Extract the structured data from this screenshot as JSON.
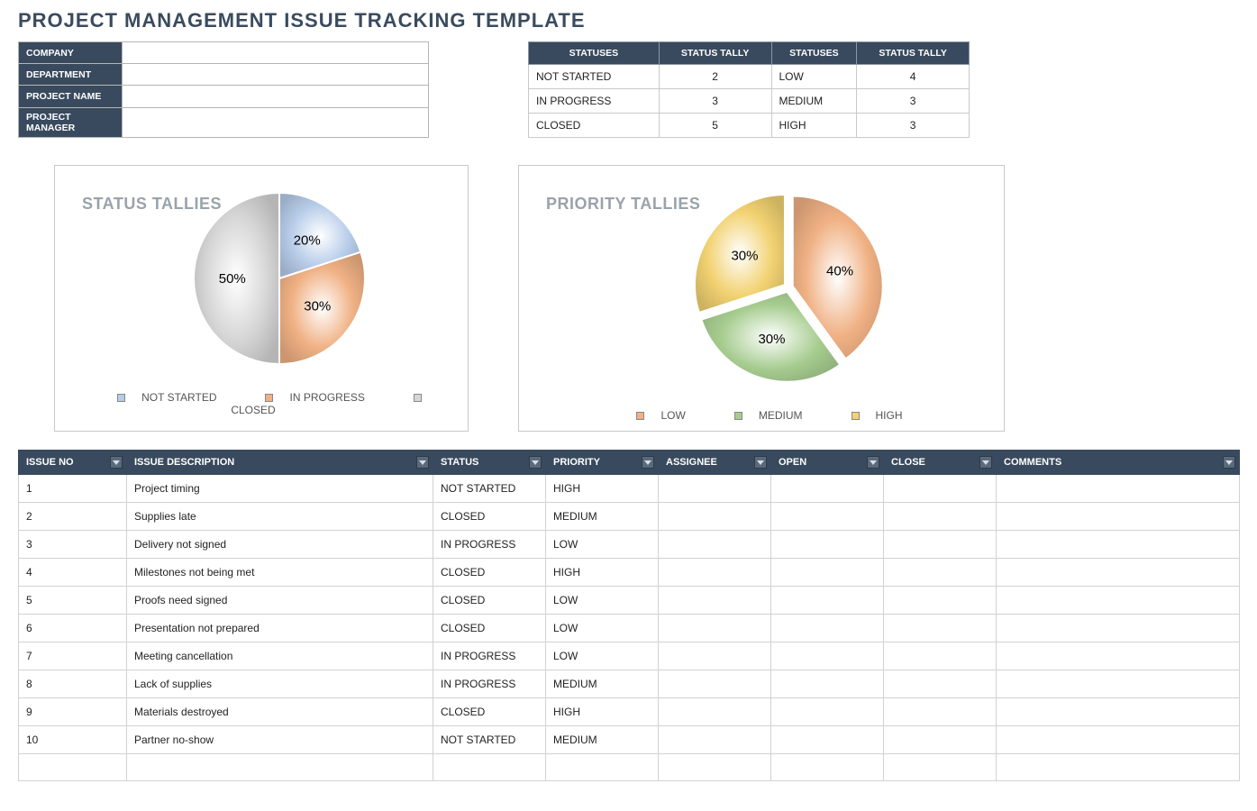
{
  "title": "PROJECT MANAGEMENT ISSUE TRACKING TEMPLATE",
  "info_fields": [
    {
      "label": "COMPANY",
      "value": ""
    },
    {
      "label": "DEPARTMENT",
      "value": ""
    },
    {
      "label": "PROJECT NAME",
      "value": ""
    },
    {
      "label": "PROJECT MANAGER",
      "value": ""
    }
  ],
  "tally_headers": [
    "STATUSES",
    "STATUS TALLY",
    "STATUSES",
    "STATUS TALLY"
  ],
  "tally_rows": [
    {
      "c1": "NOT STARTED",
      "c2": "2",
      "c3": "LOW",
      "c4": "4"
    },
    {
      "c1": "IN PROGRESS",
      "c2": "3",
      "c3": "MEDIUM",
      "c4": "3"
    },
    {
      "c1": "CLOSED",
      "c2": "5",
      "c3": "HIGH",
      "c4": "3"
    }
  ],
  "chart_data": [
    {
      "type": "pie",
      "title": "STATUS TALLIES",
      "categories": [
        "NOT STARTED",
        "IN PROGRESS",
        "CLOSED"
      ],
      "values": [
        2,
        3,
        5
      ],
      "percent_labels": [
        "20%",
        "30%",
        "50%"
      ],
      "colors": [
        "#b7cce9",
        "#f0b184",
        "#d6d6d6"
      ]
    },
    {
      "type": "pie",
      "title": "PRIORITY TALLIES",
      "categories": [
        "LOW",
        "MEDIUM",
        "HIGH"
      ],
      "values": [
        4,
        3,
        3
      ],
      "percent_labels": [
        "40%",
        "30%",
        "30%"
      ],
      "colors": [
        "#f0b184",
        "#a6cc8f",
        "#f2d272"
      ]
    }
  ],
  "issue_headers": [
    "ISSUE NO",
    "ISSUE DESCRIPTION",
    "STATUS",
    "PRIORITY",
    "ASSIGNEE",
    "OPEN",
    "CLOSE",
    "COMMENTS"
  ],
  "issue_col_widths": [
    "120",
    "340",
    "125",
    "125",
    "125",
    "125",
    "125",
    "270"
  ],
  "issues": [
    {
      "no": "1",
      "desc": "Project timing",
      "status": "NOT STARTED",
      "priority": "HIGH",
      "assignee": "",
      "open": "",
      "close": "",
      "comments": ""
    },
    {
      "no": "2",
      "desc": "Supplies late",
      "status": "CLOSED",
      "priority": "MEDIUM",
      "assignee": "",
      "open": "",
      "close": "",
      "comments": ""
    },
    {
      "no": "3",
      "desc": "Delivery not signed",
      "status": "IN PROGRESS",
      "priority": "LOW",
      "assignee": "",
      "open": "",
      "close": "",
      "comments": ""
    },
    {
      "no": "4",
      "desc": "Milestones not being met",
      "status": "CLOSED",
      "priority": "HIGH",
      "assignee": "",
      "open": "",
      "close": "",
      "comments": ""
    },
    {
      "no": "5",
      "desc": "Proofs need signed",
      "status": "CLOSED",
      "priority": "LOW",
      "assignee": "",
      "open": "",
      "close": "",
      "comments": ""
    },
    {
      "no": "6",
      "desc": "Presentation not prepared",
      "status": "CLOSED",
      "priority": "LOW",
      "assignee": "",
      "open": "",
      "close": "",
      "comments": ""
    },
    {
      "no": "7",
      "desc": "Meeting cancellation",
      "status": "IN PROGRESS",
      "priority": "LOW",
      "assignee": "",
      "open": "",
      "close": "",
      "comments": ""
    },
    {
      "no": "8",
      "desc": "Lack of supplies",
      "status": "IN PROGRESS",
      "priority": "MEDIUM",
      "assignee": "",
      "open": "",
      "close": "",
      "comments": ""
    },
    {
      "no": "9",
      "desc": "Materials destroyed",
      "status": "CLOSED",
      "priority": "HIGH",
      "assignee": "",
      "open": "",
      "close": "",
      "comments": ""
    },
    {
      "no": "10",
      "desc": "Partner no-show",
      "status": "NOT STARTED",
      "priority": "MEDIUM",
      "assignee": "",
      "open": "",
      "close": "",
      "comments": ""
    },
    {
      "no": "",
      "desc": "",
      "status": "",
      "priority": "",
      "assignee": "",
      "open": "",
      "close": "",
      "comments": ""
    }
  ]
}
